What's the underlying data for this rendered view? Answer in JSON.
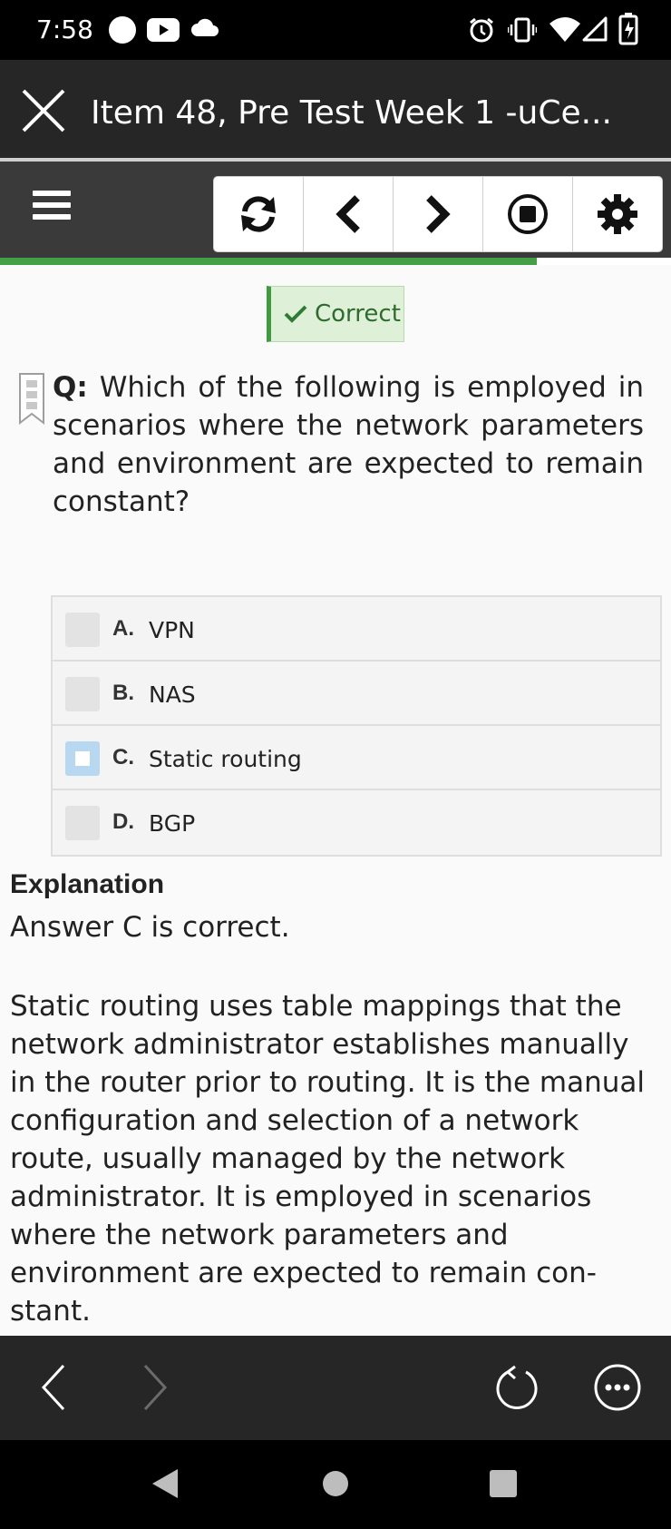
{
  "status_bar": {
    "time": "7:58",
    "icons": [
      "circle-icon",
      "youtube-icon",
      "cloud-icon",
      "alarm-icon",
      "vibrate-icon",
      "wifi-icon",
      "signal-icon",
      "battery-charging-icon"
    ]
  },
  "app_bar": {
    "close_icon": "close-icon",
    "title": "Item 48, Pre Test Week 1 -uCe..."
  },
  "toolbar": {
    "menu_icon": "hamburger-icon",
    "buttons": [
      "refresh-icon",
      "chevron-left-icon",
      "chevron-right-icon",
      "stop-icon",
      "gear-icon"
    ],
    "progress_fraction": 0.8
  },
  "result_badge": {
    "label": "Correct",
    "color": "#2e6b2e"
  },
  "question": {
    "prefix": "Q:",
    "text": "Which of the following is employed in scenarios where the network parameters and environment are expected to remain constant?"
  },
  "options": [
    {
      "letter": "A.",
      "text": "VPN",
      "selected": false
    },
    {
      "letter": "B.",
      "text": "NAS",
      "selected": false
    },
    {
      "letter": "C.",
      "text": "Static routing",
      "selected": true
    },
    {
      "letter": "D.",
      "text": "BGP",
      "selected": false
    }
  ],
  "explanation": {
    "heading": "Explanation",
    "answer": "Answer C is correct.",
    "body": "Static routing uses table mappings that the net­work administrator establishes manually in the router prior to routing. It is the manual configura­tion and selection of a network route, usually managed by the network administrator. It is em­ployed in scenarios where the network paramet­ers and environment are expected to remain con­stant."
  },
  "browser_bar": {
    "icons": [
      "back-arrow-icon",
      "forward-arrow-icon",
      "reload-icon",
      "more-options-icon"
    ]
  },
  "nav_bar": {
    "icons": [
      "nav-back-icon",
      "nav-home-icon",
      "nav-recents-icon"
    ]
  },
  "colors": {
    "accent_green": "#43a047",
    "selected_option": "#b8d7f0"
  }
}
